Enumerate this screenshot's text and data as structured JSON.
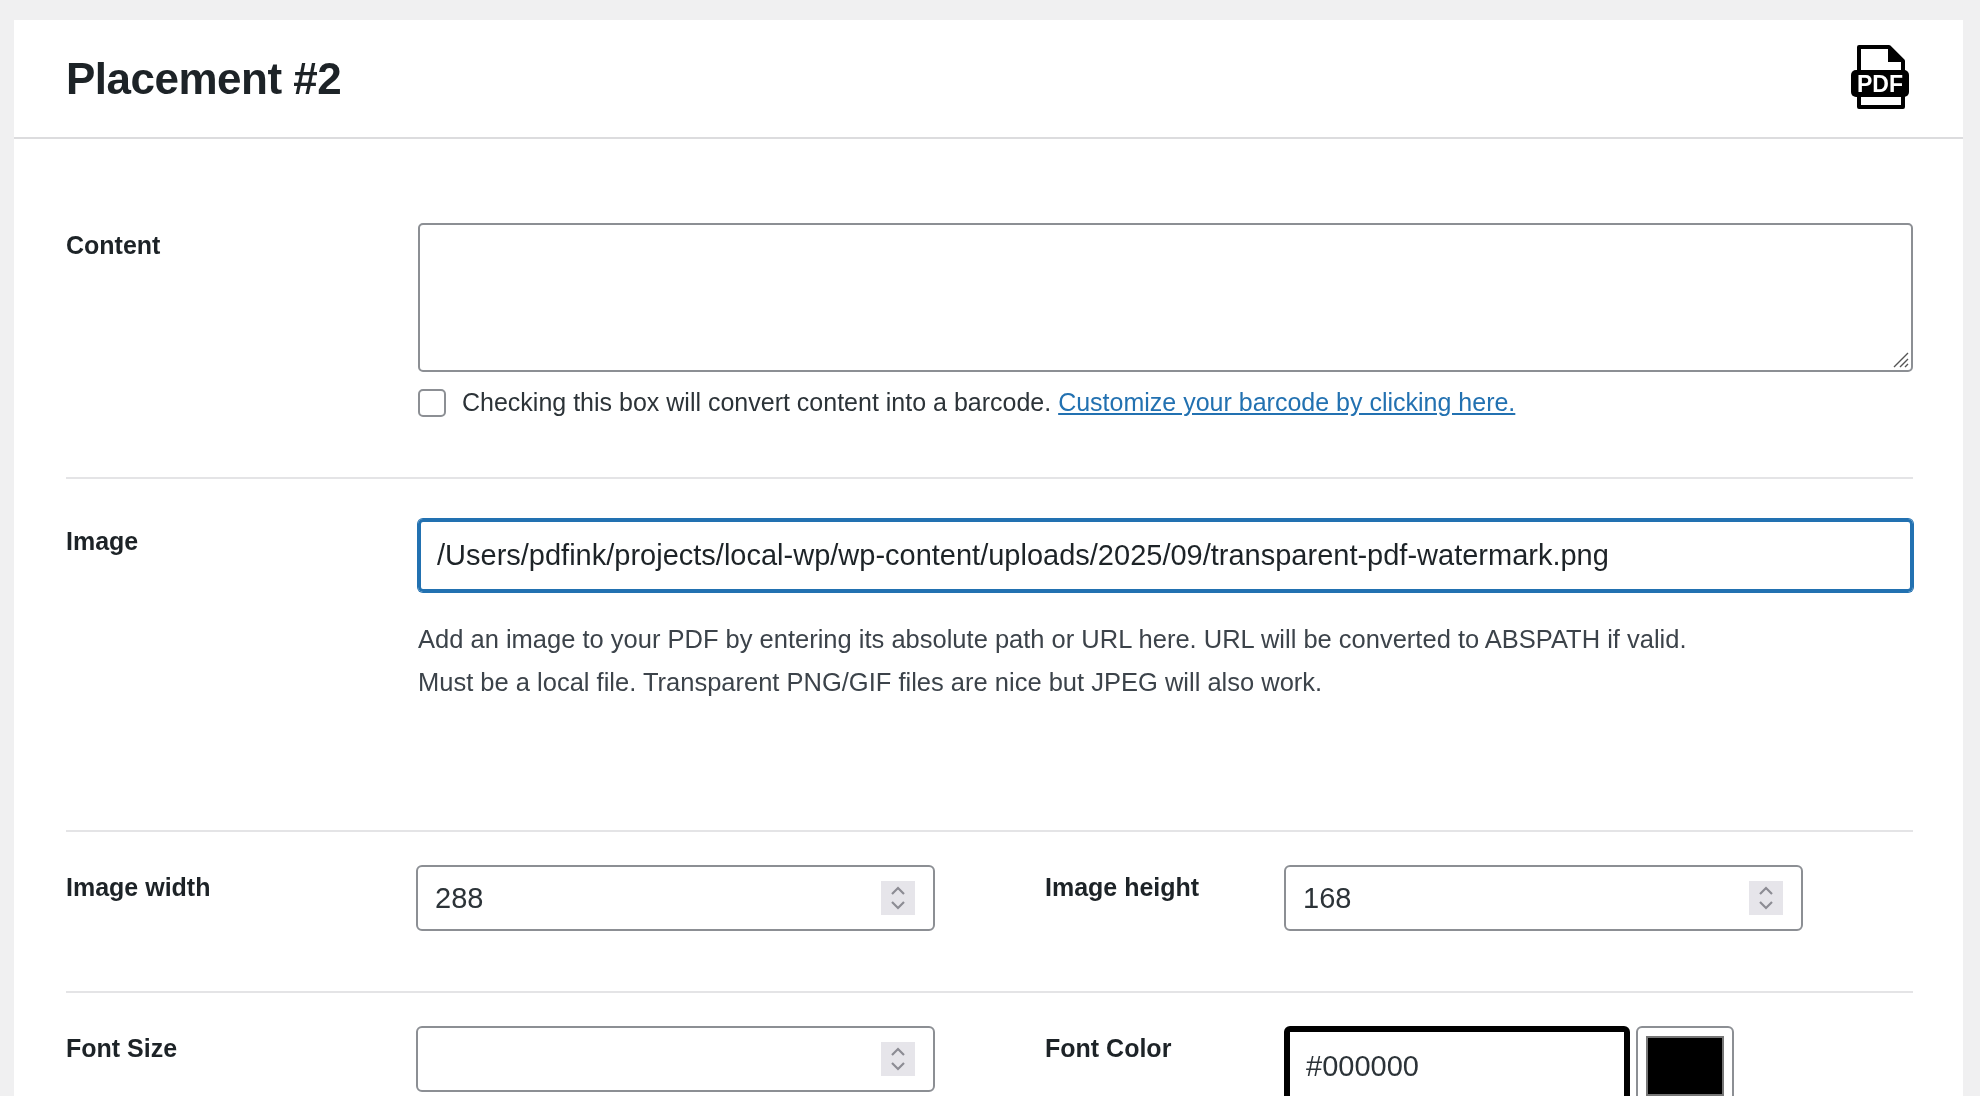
{
  "header": {
    "title": "Placement #2",
    "icon_label": "PDF"
  },
  "content": {
    "label": "Content",
    "barcode": {
      "checked": false,
      "text": "Checking this box will convert content into a barcode.",
      "link": "Customize your barcode by clicking here."
    }
  },
  "image": {
    "label": "Image",
    "value": "/Users/pdfink/projects/local-wp/wp-content/uploads/2025/09/transparent-pdf-watermark.png",
    "focused": true,
    "help": [
      "Add an image to your PDF by entering its absolute path or URL here. URL will be converted to ABSPATH if valid.",
      "Must be a local file. Transparent PNG/GIF files are nice but JPEG will also work."
    ]
  },
  "rows": [
    {
      "fields": [
        {
          "kind": "number",
          "label": "Image width",
          "value": "288"
        },
        {
          "kind": "number",
          "label": "Image height",
          "value": "168"
        }
      ]
    },
    {
      "fields": [
        {
          "kind": "number",
          "label": "Font Size"
        },
        {
          "kind": "color",
          "label": "Font Color",
          "value": "#000000"
        }
      ]
    }
  ]
}
